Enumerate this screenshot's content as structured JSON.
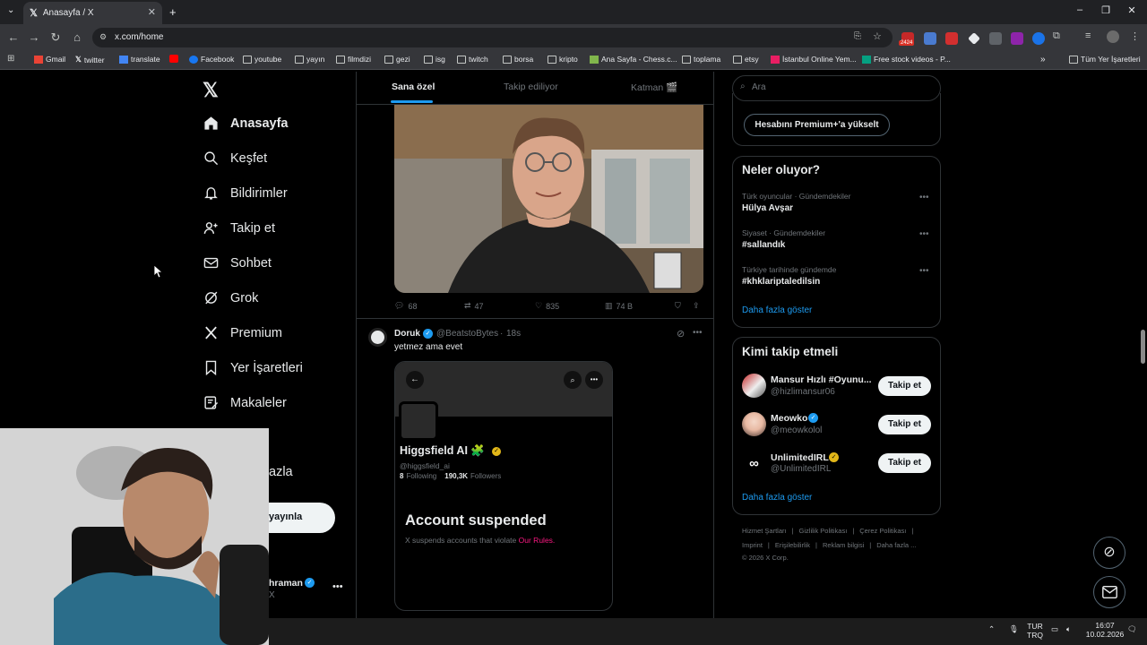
{
  "browser": {
    "tab_title": "Anasayfa / X",
    "url": "x.com/home",
    "badge_count": "2424",
    "bookmarks": [
      "Gmail",
      "twitter",
      "translate",
      "Facebook",
      "youtube",
      "yayın",
      "filmdizi",
      "gezi",
      "isg",
      "twitch",
      "borsa",
      "kripto",
      "Ana Sayfa - Chess.c...",
      "toplama",
      "etsy",
      "İstanbul Online Yem...",
      "Free stock videos - P...",
      "Tüm Yer İşaretleri"
    ]
  },
  "sidebar": {
    "items": [
      {
        "label": "Anasayfa",
        "icon": "home-icon"
      },
      {
        "label": "Keşfet",
        "icon": "search-icon"
      },
      {
        "label": "Bildirimler",
        "icon": "bell-icon"
      },
      {
        "label": "Takip et",
        "icon": "add-user-icon"
      },
      {
        "label": "Sohbet",
        "icon": "mail-icon"
      },
      {
        "label": "Grok",
        "icon": "grok-icon"
      },
      {
        "label": "Premium",
        "icon": "x-icon"
      },
      {
        "label": "Yer İşaretleri",
        "icon": "bookmark-icon"
      },
      {
        "label": "Makaleler",
        "icon": "article-icon"
      }
    ],
    "more_partial": "azla",
    "post_partial": "yayınla",
    "profile_name_partial": "hraman",
    "profile_handle_partial": "X"
  },
  "feed": {
    "tabs": [
      "Sana özel",
      "Takip ediliyor",
      "Katman 🎬"
    ],
    "post1": {
      "replies": "68",
      "reposts": "47",
      "likes": "835",
      "views": "74 B"
    },
    "post2": {
      "author": "Doruk",
      "handle": "@BeatstoBytes",
      "time": "18s",
      "text": "yetmez ama evet",
      "embed": {
        "name": "Higgsfield AI 🧩",
        "handle": "@higgsfield_ai",
        "following_count": "8",
        "following_label": "Following",
        "followers_count": "190,3K",
        "followers_label": "Followers",
        "suspended_title": "Account suspended",
        "suspended_text": "X suspends accounts that violate",
        "rules_link": "Our Rules."
      }
    }
  },
  "right": {
    "search_placeholder": "Ara",
    "premium_button": "Hesabını Premium+'a yükselt",
    "trends_title": "Neler oluyor?",
    "trends": [
      {
        "meta": "Türk oyuncular · Gündemdekiler",
        "name": "Hülya Avşar"
      },
      {
        "meta": "Siyaset · Gündemdekiler",
        "name": "#sallandık"
      },
      {
        "meta": "Türkiye tarihinde gündemde",
        "name": "#khklariptaledilsin"
      }
    ],
    "show_more": "Daha fazla göster",
    "who_title": "Kimi takip etmeli",
    "who": [
      {
        "name": "Mansur Hızlı #Oyunu...",
        "handle": "@hizlimansur06",
        "button": "Takip et"
      },
      {
        "name": "Meowko",
        "handle": "@meowkolol",
        "button": "Takip et"
      },
      {
        "name": "UnlimitedIRL",
        "handle": "@UnlimitedIRL",
        "button": "Takip et"
      }
    ],
    "footer_links": [
      "Hizmet Şartları",
      "Gizlilik Politikası",
      "Çerez Politikası",
      "Imprint",
      "Erişilebilirlik",
      "Reklam bilgisi",
      "Daha fazla ..."
    ],
    "copyright": "© 2026 X Corp."
  },
  "taskbar": {
    "lang1": "TUR",
    "lang2": "TRQ",
    "time": "16:07",
    "date": "10.02.2026"
  },
  "colors": {
    "accent": "#1d9bf0",
    "gold": "#e2b719"
  }
}
